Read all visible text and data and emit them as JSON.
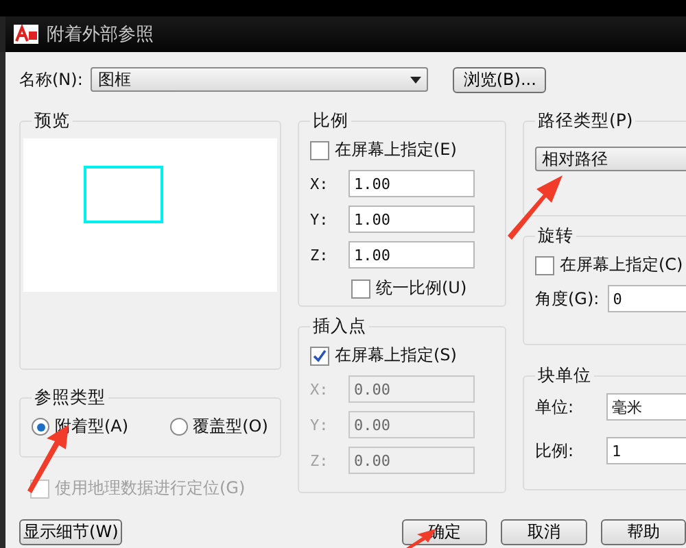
{
  "window": {
    "title": "附着外部参照"
  },
  "name_field": {
    "label": "名称(N):",
    "value": "图框"
  },
  "browse_button": "浏览(B)...",
  "preview": {
    "title": "预览"
  },
  "scale": {
    "title": "比例",
    "specify_on_screen": {
      "label": "在屏幕上指定(E)",
      "checked": false
    },
    "fields": [
      {
        "label": "X:",
        "value": "1.00",
        "disabled": false
      },
      {
        "label": "Y:",
        "value": "1.00",
        "disabled": false
      },
      {
        "label": "Z:",
        "value": "1.00",
        "disabled": false
      }
    ],
    "uniform": {
      "label": "统一比例(U)",
      "checked": false
    }
  },
  "insertion_point": {
    "title": "插入点",
    "specify_on_screen": {
      "label": "在屏幕上指定(S)",
      "checked": true
    },
    "fields": [
      {
        "label": "X:",
        "value": "0.00",
        "disabled": true
      },
      {
        "label": "Y:",
        "value": "0.00",
        "disabled": true
      },
      {
        "label": "Z:",
        "value": "0.00",
        "disabled": true
      }
    ]
  },
  "path_type": {
    "title": "路径类型(P)",
    "value": "相对路径"
  },
  "rotation": {
    "title": "旋转",
    "specify_on_screen": {
      "label": "在屏幕上指定(C)",
      "checked": false
    },
    "angle": {
      "label": "角度(G):",
      "value": "0"
    }
  },
  "block_unit": {
    "title": "块单位",
    "unit": {
      "label": "单位:",
      "value": "毫米"
    },
    "scale": {
      "label": "比例:",
      "value": "1"
    }
  },
  "reference_type": {
    "title": "参照类型",
    "options": [
      {
        "label": "附着型(A)",
        "selected": true
      },
      {
        "label": "覆盖型(O)",
        "selected": false
      }
    ]
  },
  "geo_checkbox": {
    "label": "使用地理数据进行定位(G)",
    "checked": false,
    "disabled": true
  },
  "details_button": "显示细节(W)",
  "buttons": [
    "确定",
    "取消",
    "帮助"
  ]
}
